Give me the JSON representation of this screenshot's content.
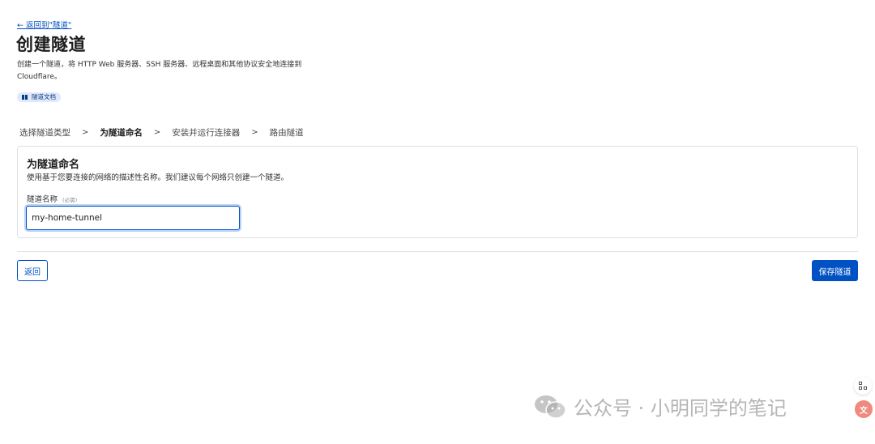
{
  "back_link": "← 返回到\"隧道\"",
  "title": "创建隧道",
  "description": "创建一个隧道，将 HTTP Web 服务器、SSH 服务器、远程桌面和其他协议安全地连接到 Cloudflare。",
  "doc_badge": "隧道文档",
  "steps": [
    {
      "label": "选择隧道类型",
      "active": false
    },
    {
      "label": "为隧道命名",
      "active": true
    },
    {
      "label": "安装并运行连接器",
      "active": false
    },
    {
      "label": "路由隧道",
      "active": false
    }
  ],
  "step_separator": ">",
  "card": {
    "title": "为隧道命名",
    "description": "使用基于您要连接的网络的描述性名称。我们建议每个网络只创建一个隧道。",
    "field_label": "隧道名称",
    "field_required": "(必需)",
    "input_value": "my-home-tunnel"
  },
  "buttons": {
    "back": "返回",
    "save": "保存隧道"
  },
  "floating": {
    "translate_glyph": "文"
  },
  "watermark": "公众号 · 小明同学的笔记",
  "colors": {
    "accent": "#0051c3",
    "badge_bg": "#dfe9fb",
    "border": "#e0e0e0"
  },
  "icons": [
    "book-icon",
    "grid-icon",
    "translate-icon",
    "wechat-icon"
  ]
}
